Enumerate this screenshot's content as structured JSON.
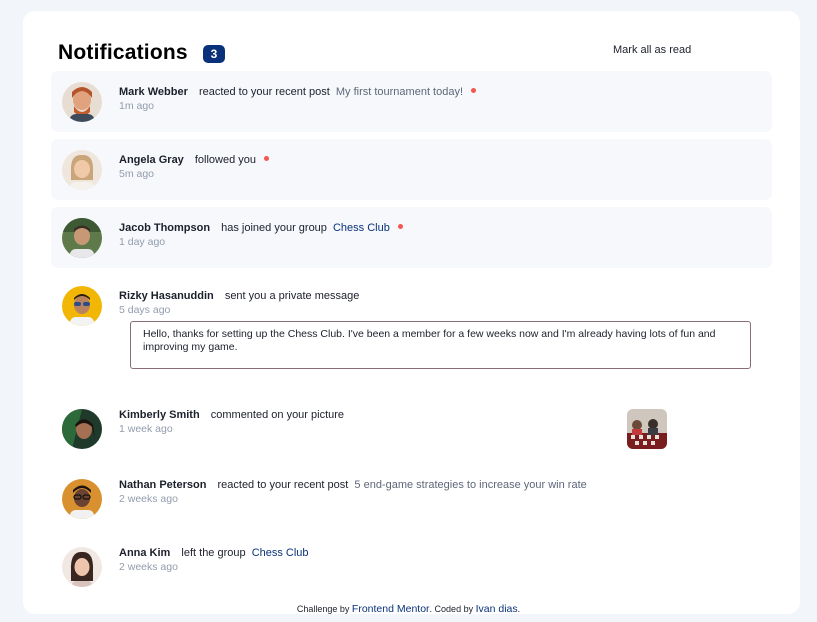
{
  "header": {
    "title": "Notifications",
    "unread_count": "3",
    "mark_all_label": "Mark all as read"
  },
  "notifications": [
    {
      "name": "Mark Webber",
      "action": "reacted to your recent post",
      "target": "My first tournament today!",
      "time": "1m ago",
      "unread": true
    },
    {
      "name": "Angela Gray",
      "action": "followed you",
      "target": "",
      "time": "5m ago",
      "unread": true
    },
    {
      "name": "Jacob Thompson",
      "action": "has joined your group",
      "target": "Chess Club",
      "time": "1 day ago",
      "unread": true
    },
    {
      "name": "Rizky Hasanuddin",
      "action": "sent you a private message",
      "target": "",
      "time": "5 days ago",
      "unread": false,
      "message": "Hello, thanks for setting up the Chess Club. I've been a member for a few weeks now and I'm already having lots of fun and improving my game."
    },
    {
      "name": "Kimberly Smith",
      "action": "commented on your picture",
      "target": "",
      "time": "1 week ago",
      "unread": false
    },
    {
      "name": "Nathan Peterson",
      "action": "reacted to your recent post",
      "target": "5 end-game strategies to increase your win rate",
      "time": "2 weeks ago",
      "unread": false
    },
    {
      "name": "Anna Kim",
      "action": "left the group",
      "target": "Chess Club",
      "time": "2 weeks ago",
      "unread": false
    }
  ],
  "footer": {
    "prefix": "Challenge by",
    "mentor": "Frontend Mentor",
    "middle": ". Coded by",
    "author": "Ivan dias",
    "suffix": "."
  },
  "colors": {
    "badge": "#0a327b",
    "unread_dot": "#f65552",
    "unread_bg": "#f6f8fc",
    "time": "#939cad",
    "link": "#0a327b"
  }
}
